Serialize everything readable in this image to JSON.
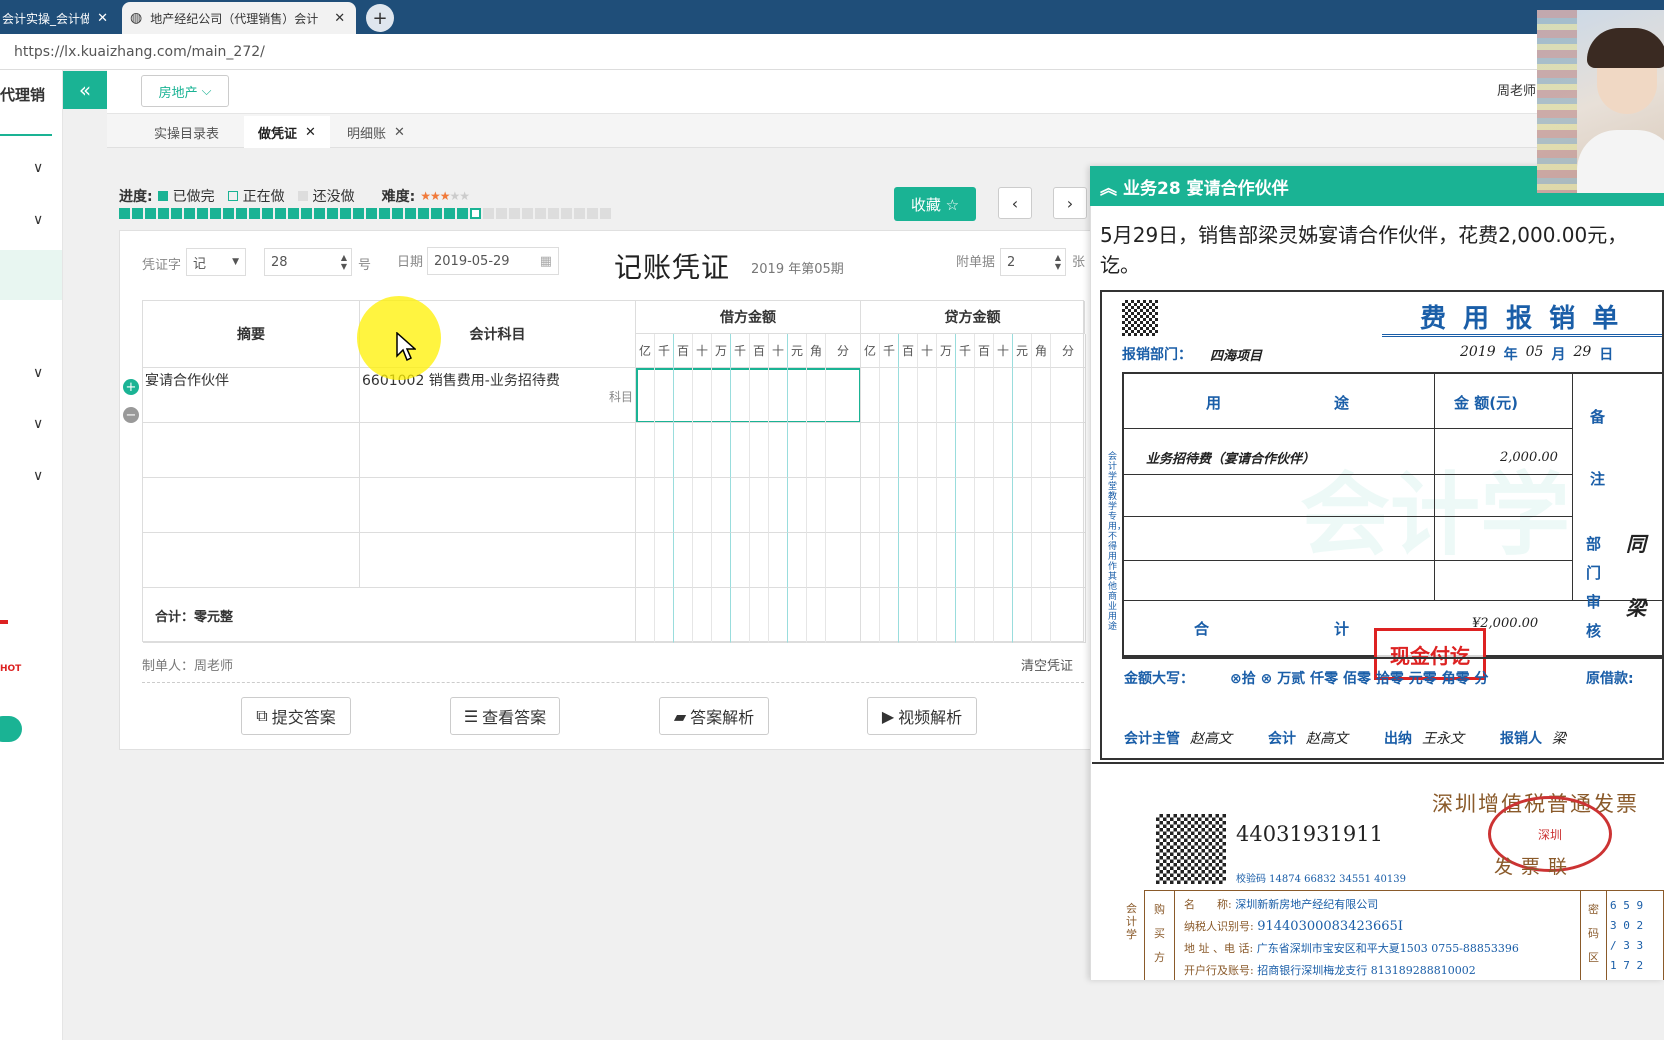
{
  "browser": {
    "tabs": [
      {
        "label": "会计实操_会计做",
        "active": false
      },
      {
        "label": "地产经纪公司（代理销售）会计",
        "active": true
      }
    ],
    "url": "https://lx.kuaizhang.com/main_272/"
  },
  "sidebar": {
    "title": "代理销",
    "collapse_icon": "«"
  },
  "topbar": {
    "industry_dropdown": "房地产",
    "user": "周老师"
  },
  "subtabs": [
    {
      "label": "实操目录表",
      "active": false,
      "closable": false
    },
    {
      "label": "做凭证",
      "active": true,
      "closable": true
    },
    {
      "label": "明细账",
      "active": false,
      "closable": true
    }
  ],
  "progress": {
    "label": "进度:",
    "done_label": "已做完",
    "doing_label": "正在做",
    "todo_label": "还没做",
    "difficulty_label": "难度:",
    "difficulty_stars": 3,
    "difficulty_max": 5,
    "done_count": 27,
    "current_index": 28,
    "total": 38
  },
  "actions": {
    "favorite": "收藏 ☆",
    "prev": "‹",
    "next": "›"
  },
  "voucher": {
    "word_label": "凭证字",
    "word_value": "记",
    "number_value": "28",
    "number_suffix": "号",
    "date_label": "日期",
    "date_value": "2019-05-29",
    "title": "记账凭证",
    "period": "2019 年第05期",
    "attach_label": "附单据",
    "attach_value": "2",
    "attach_suffix": "张",
    "col_summary": "摘要",
    "col_account": "会计科目",
    "col_debit": "借方金额",
    "col_credit": "贷方金额",
    "digits": [
      "亿",
      "千",
      "百",
      "十",
      "万",
      "千",
      "百",
      "十",
      "元",
      "角",
      "分"
    ],
    "rows": [
      {
        "summary": "宴请合作伙伴",
        "account": "6601002 销售费用-业务招待费",
        "account_hint": "科目"
      },
      {
        "summary": "",
        "account": "",
        "account_hint": ""
      },
      {
        "summary": "",
        "account": "",
        "account_hint": ""
      },
      {
        "summary": "",
        "account": "",
        "account_hint": ""
      }
    ],
    "total_label": "合计：零元整",
    "maker": "制单人：周老师",
    "clear": "清空凭证"
  },
  "buttons": {
    "submit": "提交答案",
    "view": "查看答案",
    "analysis": "答案解析",
    "video": "视频解析"
  },
  "task": {
    "title": "业务28 宴请合作伙伴",
    "description": "5月29日，销售部梁灵姊宴请合作伙伴，花费2,000.00元，讫。"
  },
  "expense_form": {
    "title": "费 用 报 销 单",
    "dept_label": "报销部门：",
    "dept_value": "四海项目",
    "date_year": "2019",
    "date_month": "05",
    "date_day": "29",
    "year_label": "年",
    "month_label": "月",
    "day_label": "日",
    "col_usage_a": "用",
    "col_usage_b": "途",
    "col_amount": "金 额(元)",
    "col_remark_a": "备",
    "col_remark_b": "注",
    "item1": "业务招待费（宴请合作伙伴）",
    "item1_amount": "2,000.00",
    "total_a": "合",
    "total_b": "计",
    "total_amount": "¥2,000.00",
    "dept_audit": [
      "部",
      "门",
      "审",
      "核"
    ],
    "dept_sign_a": "同",
    "dept_sign_b": "梁",
    "amount_words_label": "金额大写：",
    "amount_words": "⊗拾 ⊗ 万贰 仟零 佰零 拾零 元零 角零 分",
    "orig_loan": "原借款:",
    "stamp": "现金付讫",
    "supervisor_label": "会计主管",
    "supervisor": "赵高文",
    "accountant_label": "会计",
    "accountant": "赵高文",
    "cashier_label": "出纳",
    "cashier": "王永文",
    "claimant_label": "报销人",
    "claimant": "梁",
    "side_note": "会计学堂教学专用，不得用作其他商业用途",
    "watermark": "会计学"
  },
  "invoice": {
    "code": "44031931911",
    "title": "深圳增值税普通发票",
    "check_code": "校验码 14874 66832 34551 40139",
    "stamp_text": "深圳",
    "copy": "发票联",
    "buyer_label": "购买方",
    "buyer_label_chars": [
      "购",
      "买",
      "方"
    ],
    "name_label": "名　　称:",
    "name": "深圳新新房地产经纪有限公司",
    "tax_label": "纳税人识别号:",
    "tax_id": "91440300083423665I",
    "addr_label": "地 址 、电 话:",
    "addr": "广东省深圳市宝安区和平大夏1503 0755-88853396",
    "bank_label": "开户行及账号:",
    "bank": "招商银行深圳梅龙支行 813189288810002",
    "cipher_label_chars": [
      "密",
      "码",
      "区"
    ],
    "cipher": [
      "6 5 9",
      "3 0 2",
      "/ 3 3",
      "1 7 2"
    ],
    "side": "会计学"
  }
}
